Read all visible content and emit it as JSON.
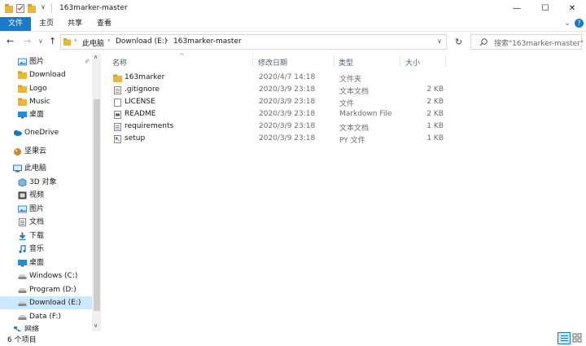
{
  "window": {
    "title": "163marker-master",
    "buttons": {
      "minimize": "—",
      "maximize": "☐",
      "close": "✕"
    }
  },
  "ribbon": {
    "tabs": [
      "文件",
      "主页",
      "共享",
      "查看"
    ],
    "expand_glyph": "⌄",
    "help_glyph": "?"
  },
  "address": {
    "breadcrumb": [
      "此电脑",
      "Download (E:)",
      "163marker-master"
    ],
    "search_placeholder": "搜索\"163marker-master\""
  },
  "nav": {
    "items": [
      {
        "label": "图片",
        "icon": "pictures-icon",
        "pinned": true
      },
      {
        "label": "Download",
        "icon": "folder-icon"
      },
      {
        "label": "Logo",
        "icon": "folder-icon"
      },
      {
        "label": "Music",
        "icon": "folder-icon"
      },
      {
        "label": "桌面",
        "icon": "desktop-icon"
      },
      {
        "label": "OneDrive",
        "icon": "onedrive-icon"
      },
      {
        "label": "坚果云",
        "icon": "jianguoyun-icon"
      },
      {
        "label": "此电脑",
        "icon": "this-pc-icon"
      },
      {
        "label": "3D 对象",
        "icon": "3d-objects-icon"
      },
      {
        "label": "视频",
        "icon": "videos-icon"
      },
      {
        "label": "图片",
        "icon": "pictures-icon"
      },
      {
        "label": "文档",
        "icon": "documents-icon"
      },
      {
        "label": "下载",
        "icon": "downloads-icon"
      },
      {
        "label": "音乐",
        "icon": "music-icon"
      },
      {
        "label": "桌面",
        "icon": "desktop-icon"
      },
      {
        "label": "Windows (C:)",
        "icon": "drive-icon"
      },
      {
        "label": "Program (D:)",
        "icon": "drive-icon"
      },
      {
        "label": "Download (E:)",
        "icon": "drive-icon",
        "selected": true
      },
      {
        "label": "Data (F:)",
        "icon": "drive-icon"
      },
      {
        "label": "网络",
        "icon": "network-icon"
      }
    ]
  },
  "columns": {
    "name": "名称",
    "date": "修改日期",
    "type": "类型",
    "size": "大小"
  },
  "files": [
    {
      "name": "163marker",
      "date": "2020/4/7 14:18",
      "type": "文件夹",
      "size": "",
      "icon": "folder-icon"
    },
    {
      "name": ".gitignore",
      "date": "2020/3/9 23:18",
      "type": "文本文档",
      "size": "2 KB",
      "icon": "text-file-icon"
    },
    {
      "name": "LICENSE",
      "date": "2020/3/9 23:18",
      "type": "文件",
      "size": "2 KB",
      "icon": "blank-file-icon"
    },
    {
      "name": "README",
      "date": "2020/3/9 23:18",
      "type": "Markdown File",
      "size": "2 KB",
      "icon": "markdown-file-icon"
    },
    {
      "name": "requirements",
      "date": "2020/3/9 23:18",
      "type": "文本文档",
      "size": "1 KB",
      "icon": "text-file-icon"
    },
    {
      "name": "setup",
      "date": "2020/3/9 23:18",
      "type": "PY 文件",
      "size": "1 KB",
      "icon": "python-file-icon"
    }
  ],
  "status": {
    "count": "6 个项目"
  },
  "colors": {
    "accent": "#1979ca",
    "selection": "#cce8ff",
    "folder": "#e8b73b",
    "header_text": "#4c607a"
  }
}
